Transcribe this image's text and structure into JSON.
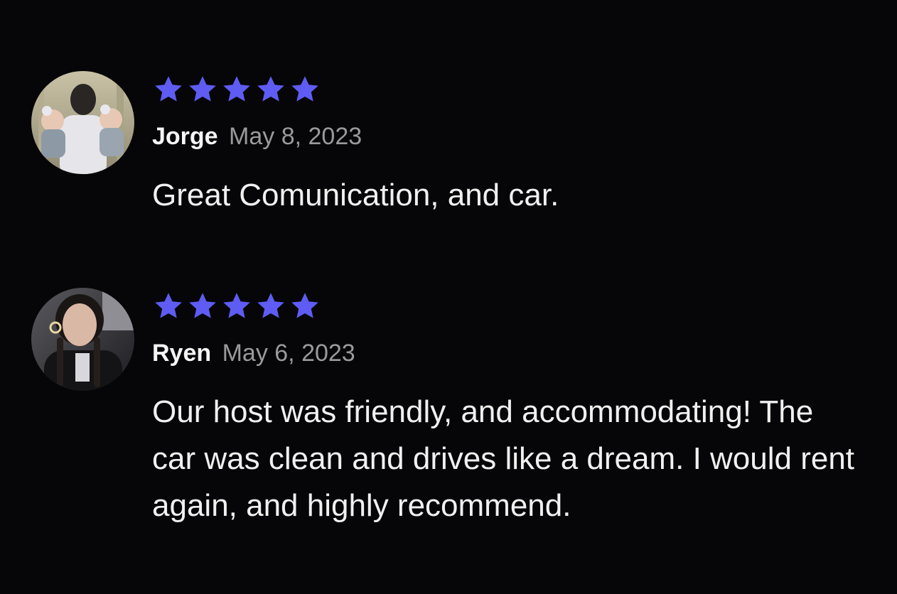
{
  "accent_color": "#5e5cf2",
  "reviews": [
    {
      "avatar_icon": "user-photo-avatar",
      "rating": 5,
      "name": "Jorge",
      "date": "May 8, 2023",
      "text": "Great Comunication, and car."
    },
    {
      "avatar_icon": "user-photo-avatar",
      "rating": 5,
      "name": "Ryen",
      "date": "May 6, 2023",
      "text": "Our host was friendly, and accommodating! The car was clean and drives like a dream. I would rent again, and highly recommend."
    }
  ]
}
